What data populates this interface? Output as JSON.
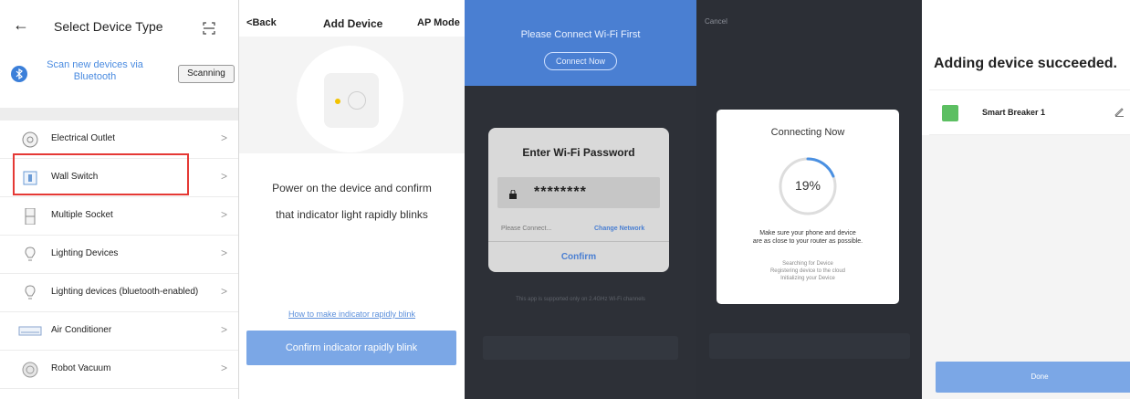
{
  "panel1": {
    "back_icon": "arrow-left-icon",
    "title": "Select Device Type",
    "scan_icon": "qr-scan-icon",
    "bluetooth": {
      "icon": "bluetooth-icon",
      "text": "Scan new devices via Bluetooth",
      "button": "Scanning"
    },
    "devices": [
      {
        "label": "Electrical Outlet",
        "icon": "outlet-icon"
      },
      {
        "label": "Wall Switch",
        "icon": "wall-switch-icon"
      },
      {
        "label": "Multiple Socket",
        "icon": "power-strip-icon"
      },
      {
        "label": "Lighting Devices",
        "icon": "bulb-icon"
      },
      {
        "label": "Lighting devices (bluetooth-enabled)",
        "icon": "bulb-bt-icon"
      },
      {
        "label": "Air Conditioner",
        "icon": "ac-icon"
      },
      {
        "label": "Robot Vacuum",
        "icon": "vacuum-icon"
      }
    ],
    "highlight_color": "#e53935"
  },
  "panel2": {
    "back": "Back",
    "title": "Add Device",
    "mode": "AP Mode",
    "instruction_line1": "Power on the device and confirm",
    "instruction_line2": "that indicator light rapidly blinks",
    "help_link": "How to make indicator rapidly blink",
    "confirm_button": "Confirm indicator rapidly blink",
    "accent": "#7ba7e6"
  },
  "panel3": {
    "banner_title": "Please Connect Wi-Fi First",
    "connect_button": "Connect Now",
    "dialog": {
      "title": "Enter Wi-Fi Password",
      "password_mask": "********",
      "hint": "Please Connect...",
      "change_network": "Change Network",
      "confirm": "Confirm"
    },
    "footer": "This app is supported only on 2.4GHz Wi-Fi channels",
    "accent": "#4a7fd2"
  },
  "panel4": {
    "cancel": "Cancel",
    "title": "Connecting Now",
    "progress": 0.19,
    "progress_label": "19%",
    "message_line1": "Make sure your phone and device",
    "message_line2": "are as close to your router as possible.",
    "steps": [
      "Searching for Device",
      "Registering device to the cloud",
      "Initializing your Device"
    ]
  },
  "panel5": {
    "title": "Adding device succeeded.",
    "device_name": "Smart Breaker 1",
    "edit_icon": "pencil-icon",
    "done_button": "Done",
    "accent": "#7ba7e6"
  }
}
